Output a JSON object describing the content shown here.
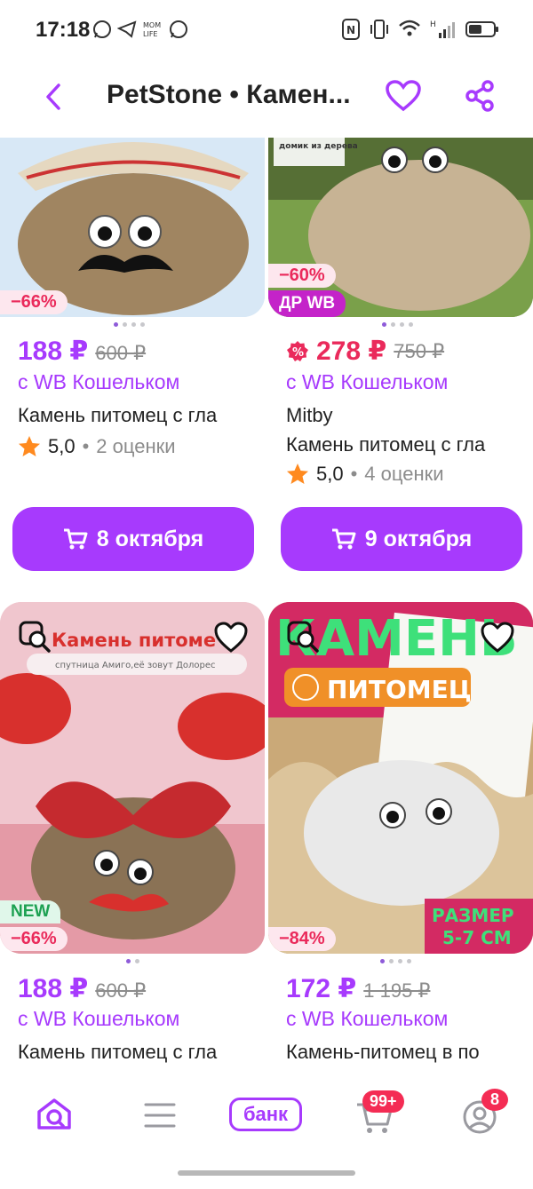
{
  "status_bar": {
    "time": "17:18"
  },
  "header": {
    "title": "PetStone • Камен..."
  },
  "products": [
    {
      "discount": "−66%",
      "price": "188 ₽",
      "old_price": "600 ₽",
      "wallet": "с WB Кошельком",
      "name": "Камень питомец с гла",
      "rating": "5,0",
      "reviews": "2 оценки",
      "delivery": "8 октября"
    },
    {
      "discount": "−60%",
      "tag": "ДР WB",
      "price": "278 ₽",
      "old_price": "750 ₽",
      "wallet": "с WB Кошельком",
      "brand": "Mitby",
      "name": "Камень питомец с гла",
      "rating": "5,0",
      "reviews": "4 оценки",
      "delivery": "9 октября",
      "image_text": "домик из дерева"
    },
    {
      "new": "NEW",
      "discount": "−66%",
      "price": "188 ₽",
      "old_price": "600 ₽",
      "wallet": "с WB Кошельком",
      "name": "Камень питомец с гла",
      "image_title": "Камень питоме",
      "image_subtitle": "спутница Амиго,её зовут Долорес"
    },
    {
      "discount": "−84%",
      "price": "172 ₽",
      "old_price": "1 195 ₽",
      "wallet": "с WB Кошельком",
      "name": "Камень-питомец в по",
      "image_title": "КАМЕНЬ",
      "image_subtitle": "ПИТОМЕЦ",
      "image_size": "РАЗМЕР\n5-7 СМ"
    }
  ],
  "nav": {
    "bank_label": "банк",
    "cart_badge": "99+",
    "profile_badge": "8"
  },
  "colors": {
    "accent": "#a73afd",
    "discount_red": "#ea2a5b"
  }
}
